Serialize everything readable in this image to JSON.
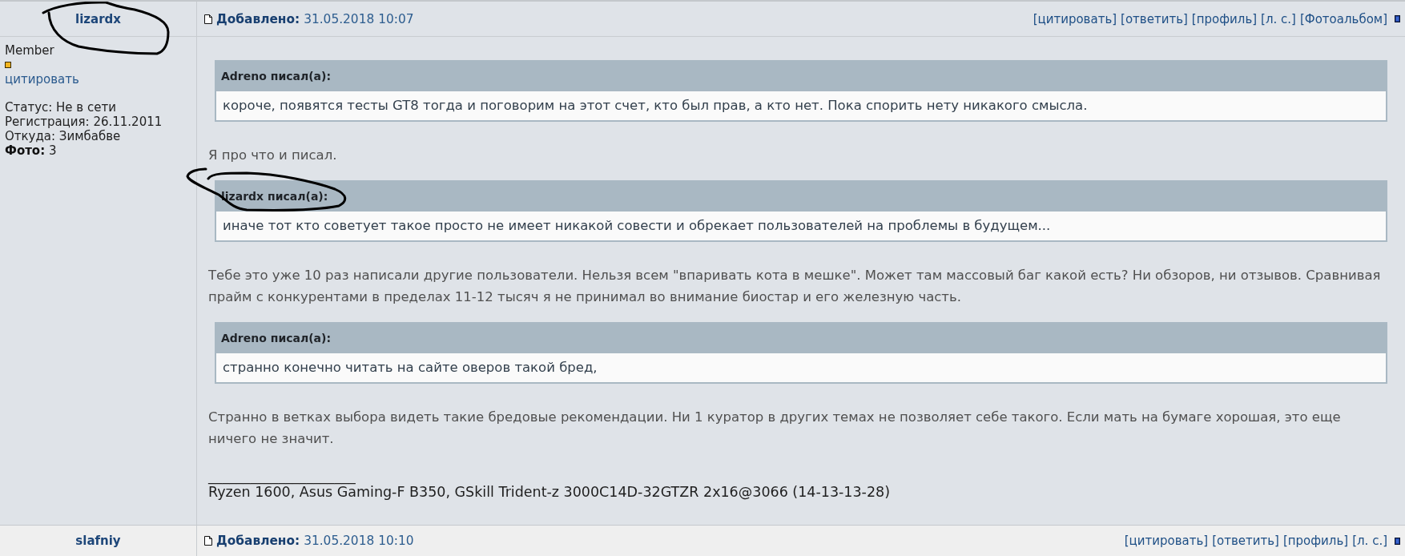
{
  "posts": [
    {
      "author": "lizardx",
      "date": "**Добавлено:** 31.05.2018 10:07",
      "actions": [
        "[цитировать]",
        "[ответить]",
        "[профиль]",
        "[л. с.]",
        "[Фотоальбом]"
      ],
      "profile": {
        "rank": "Member",
        "quote_link": "цитировать",
        "details": [
          "Статус: Не в сети",
          "Регистрация: 26.11.2011",
          "Откуда: Зимбабве",
          "**Фото:** 3"
        ]
      },
      "body": [
        {
          "kind": "quote",
          "author": "Adreno писал(а):",
          "text": "короче, появятся тесты GT8 тогда и поговорим на этот счет, кто был прав, а кто нет. Пока спорить нету никакого смысла."
        },
        {
          "kind": "paragraph",
          "text": "Я про что и писал."
        },
        {
          "kind": "quote",
          "author": "lizardx писал(а):",
          "text": "иначе тот кто советует такое просто не имеет никакой совести и обрекает пользователей на проблемы в будущем..."
        },
        {
          "kind": "paragraph",
          "text": "Тебе это уже 10 раз написали другие пользователи. Нельзя всем \"впаривать кота в мешке\". Может там массовый баг какой есть? Ни обзоров, ни отзывов. Сравнивая прайм с конкурентами в пределах 11-12 тысяч я не принимал во внимание биостар и его железную часть."
        },
        {
          "kind": "quote",
          "author": "Adreno писал(а):",
          "text": "странно конечно читать на сайте оверов такой бред,"
        },
        {
          "kind": "paragraph",
          "text": "Странно в ветках выбора видеть такие бредовые рекомендации. Ни 1 куратор в других темах не позволяет себе такого. Если мать на бумаге хорошая, это еще ничего не значит."
        }
      ],
      "signature": {
        "rule": "_____________________",
        "text": "Ryzen 1600, Asus Gaming-F B350, GSkill Trident-z 3000C14D-32GTZR 2x16@3066 (14-13-13-28)"
      }
    },
    {
      "author": "slafniy",
      "date": "**Добавлено:** 31.05.2018 10:10",
      "actions": [
        "[цитировать]",
        "[ответить]",
        "[профиль]",
        "[л. с.]"
      ]
    }
  ]
}
